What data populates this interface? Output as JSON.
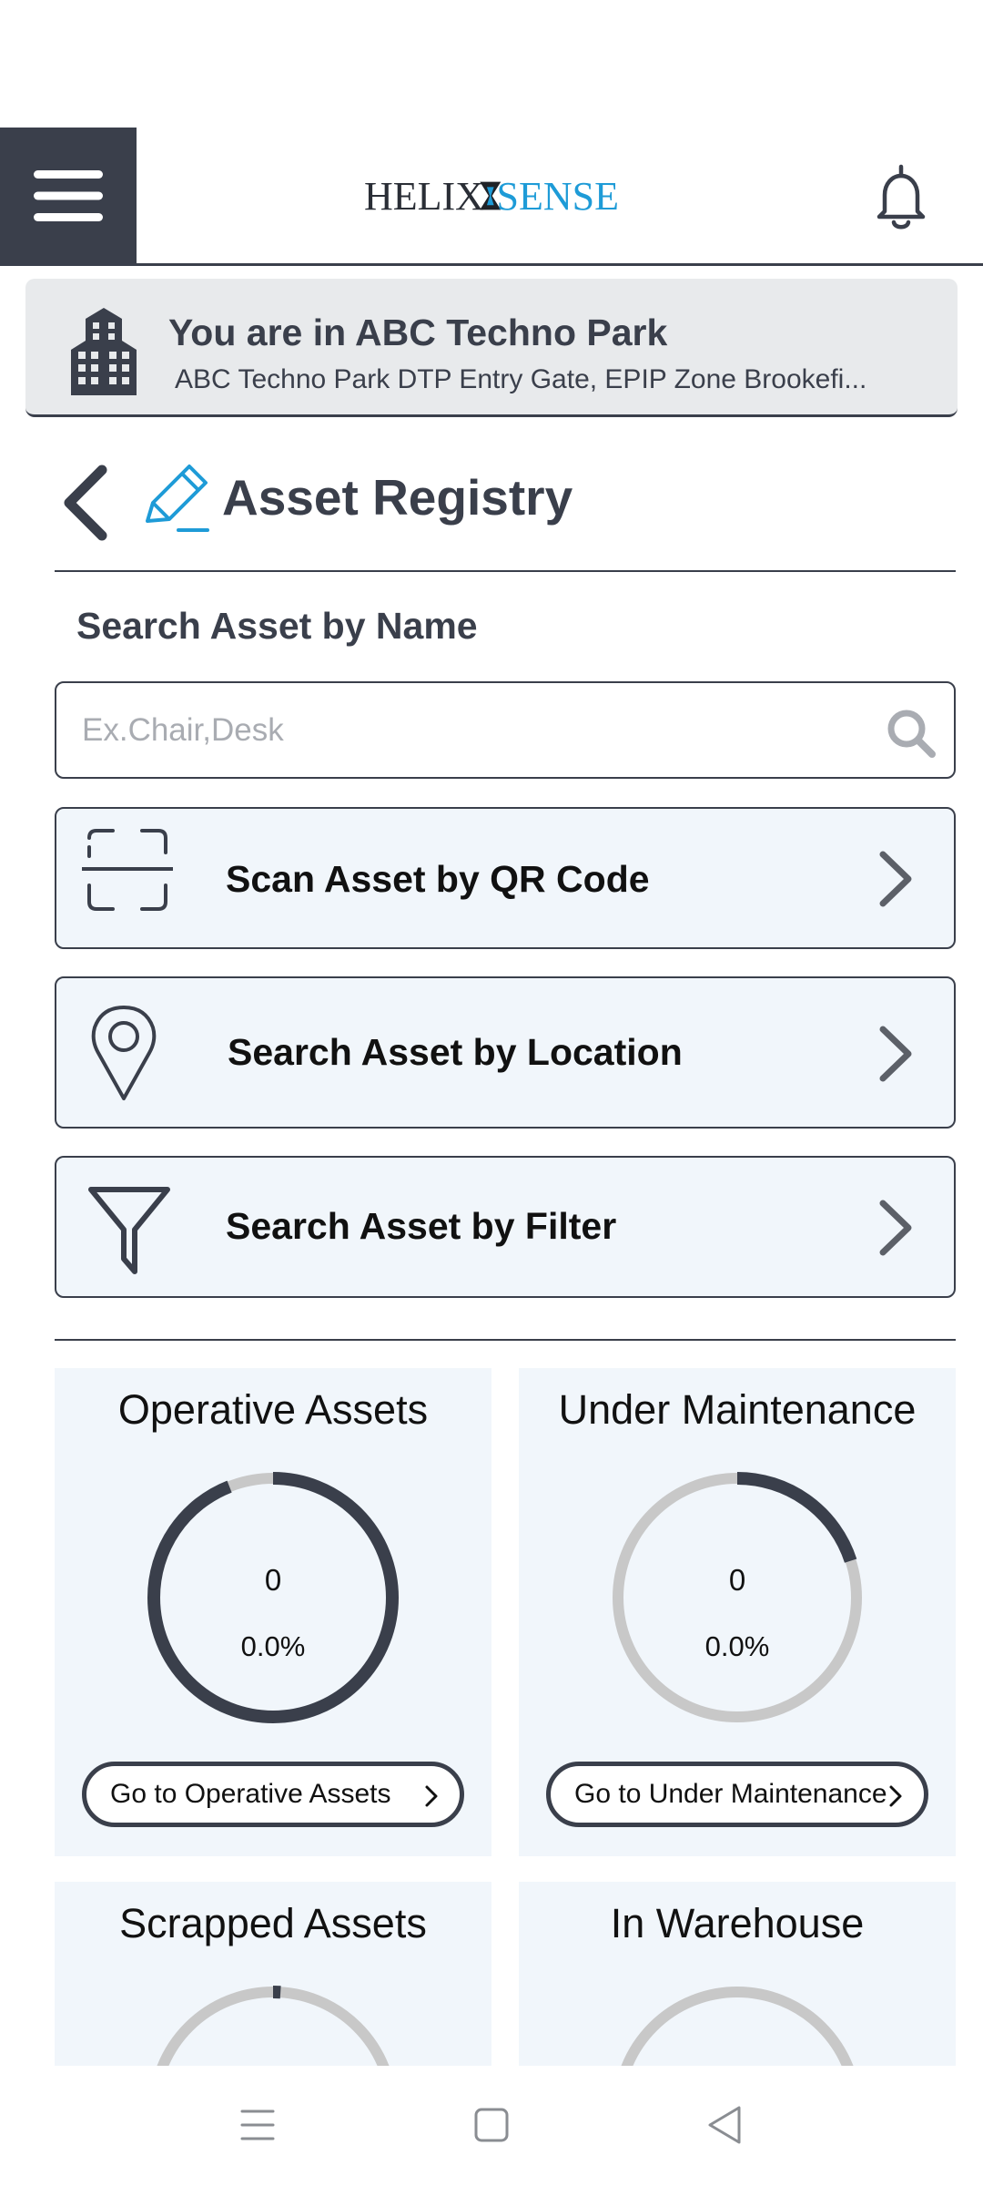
{
  "header": {
    "logo_left": "HELIX",
    "logo_right": "SENSE",
    "menu_icon": "hamburger-menu-icon",
    "bell_icon": "bell-icon"
  },
  "site": {
    "title": "You are in ABC Techno Park",
    "subtitle": "ABC Techno Park DTP Entry Gate, EPIP Zone Brookefi..."
  },
  "page": {
    "title": "Asset Registry"
  },
  "search": {
    "label": "Search Asset by Name",
    "placeholder": "Ex.Chair,Desk"
  },
  "options": [
    {
      "label": "Scan Asset by QR Code",
      "icon": "qr-scan-icon"
    },
    {
      "label": "Search Asset by Location",
      "icon": "location-pin-icon"
    },
    {
      "label": "Search Asset by Filter",
      "icon": "filter-icon"
    }
  ],
  "stats": [
    {
      "title": "Operative Assets",
      "count": "0",
      "percent": "0.0%",
      "fill": 0.94,
      "button": "Go to Operative Assets"
    },
    {
      "title": "Under Maintenance",
      "count": "0",
      "percent": "0.0%",
      "fill": 0.2,
      "button": "Go to Under Maintenance"
    },
    {
      "title": "Scrapped Assets",
      "fill": 0.01
    },
    {
      "title": "In Warehouse",
      "fill": 0
    }
  ],
  "colors": {
    "primary": "#3a3f4b",
    "accent": "#1e9bd7",
    "card_bg": "#f1f6fb",
    "track": "#c8c8c8"
  }
}
